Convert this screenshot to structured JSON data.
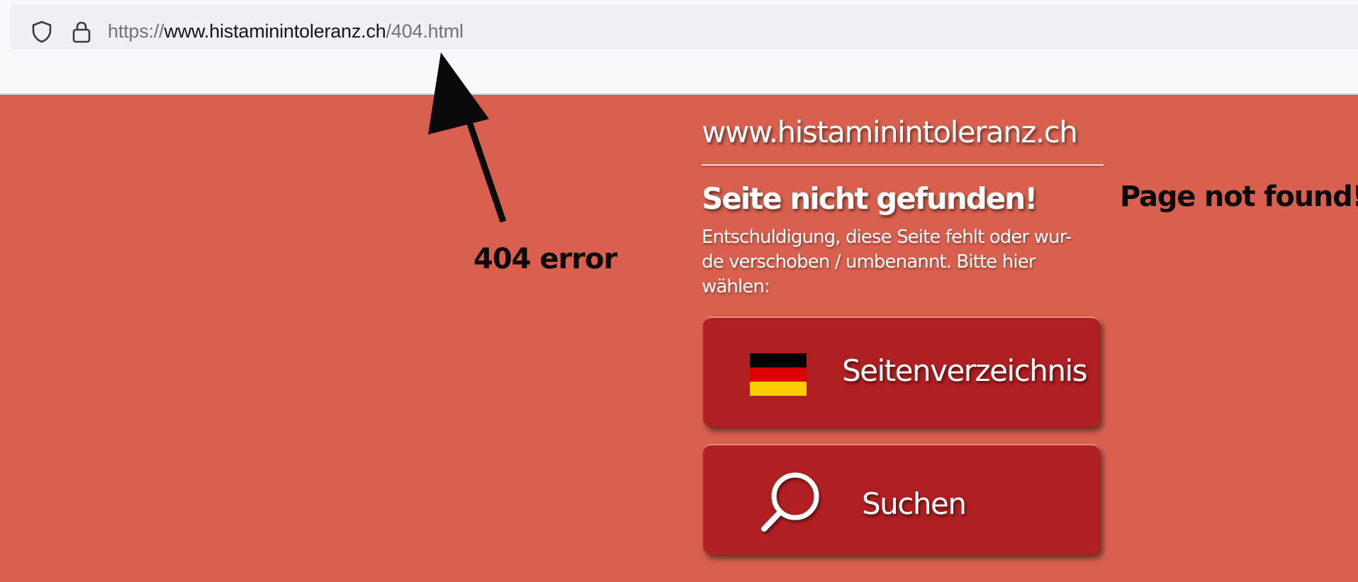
{
  "browser": {
    "url": {
      "protocol": "https://",
      "domain": "www.histaminintoleranz.ch",
      "path": "/404.html"
    },
    "icons": [
      "shield-icon",
      "lock-icon"
    ]
  },
  "annotations": {
    "error_label": "404 error",
    "translation_label": "Page not found!"
  },
  "page": {
    "site_title": "www.histaminintoleranz.ch",
    "heading": "Seite nicht gefunden!",
    "message_lines": [
      "Entschuldigung, diese Seite fehlt oder wur-",
      "de verschoben / umbenannt. Bitte hier",
      "wählen:"
    ],
    "buttons": [
      {
        "label": "Seitenverzeichnis",
        "icon": "german-flag-icon"
      },
      {
        "label": "Suchen",
        "icon": "search-icon"
      }
    ]
  },
  "colors": {
    "page_background": "#d9604e",
    "button_background": "#b01f22",
    "text": "#ffffff",
    "flag": [
      "#000000",
      "#dd0000",
      "#ffce00"
    ]
  }
}
